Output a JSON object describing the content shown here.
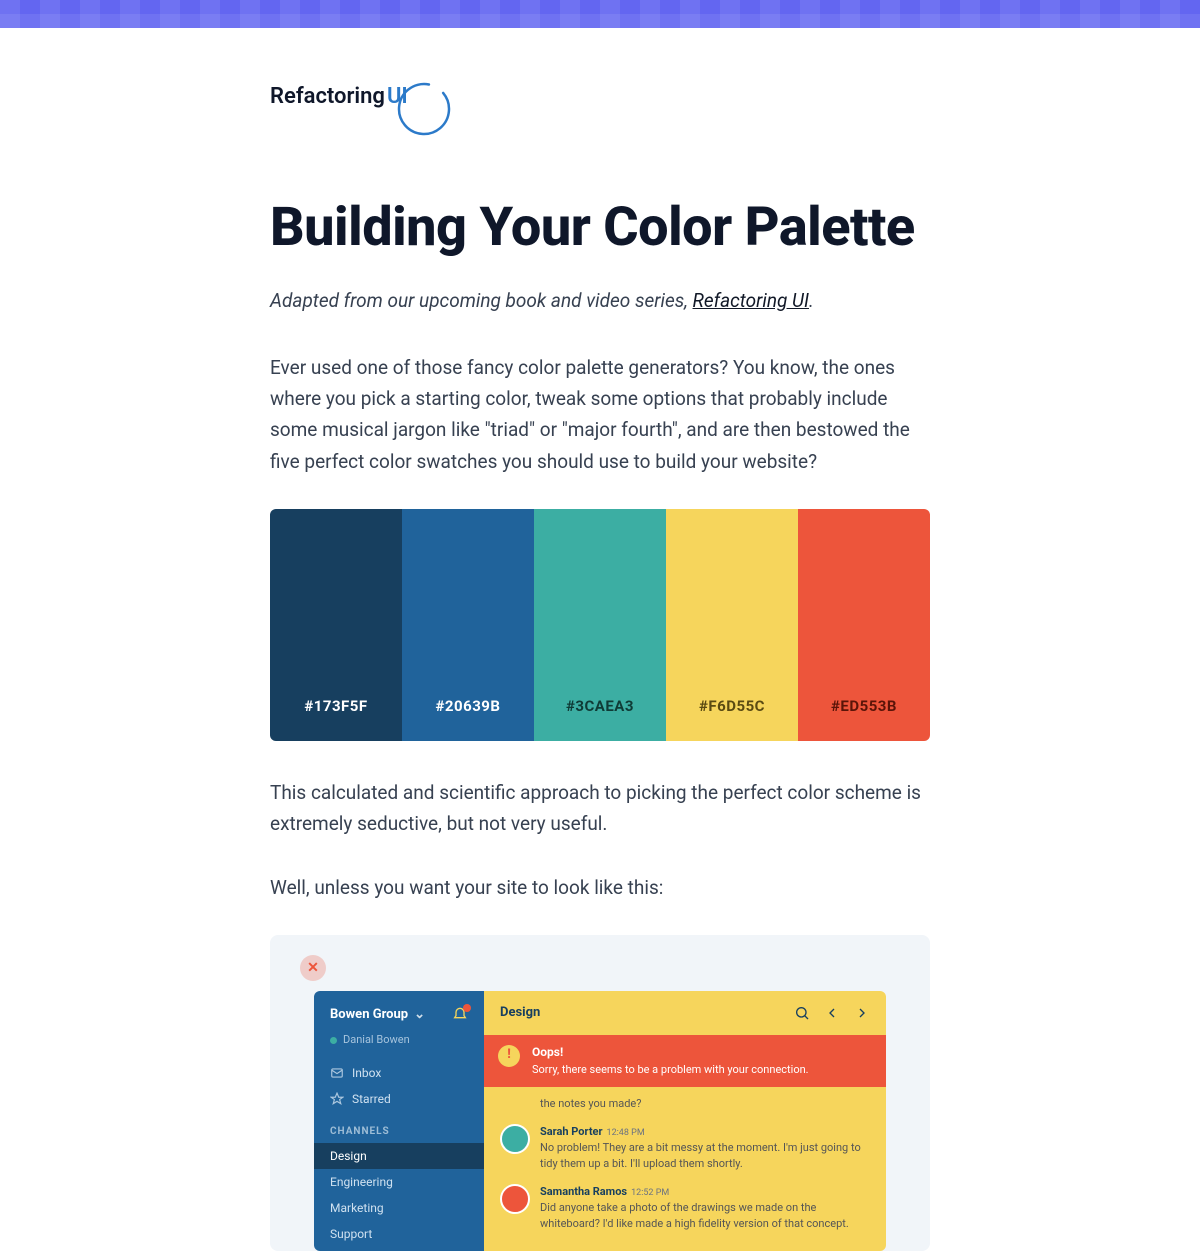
{
  "logo": {
    "word1": "Refactoring",
    "word2": "UI"
  },
  "title": "Building Your Color Palette",
  "intro": {
    "prefix": "Adapted from our upcoming book and video series, ",
    "link_text": "Refactoring UI",
    "suffix": "."
  },
  "body1": "Ever used one of those fancy color palette generators? You know, the ones where you pick a starting color, tweak some options that probably include some musical jargon like \"triad\" or \"major fourth\", and are then bestowed the five perfect color swatches you should use to build your website?",
  "palette": [
    {
      "hex": "#173F5F",
      "label_color": "#ffffff"
    },
    {
      "hex": "#20639B",
      "label_color": "#ffffff"
    },
    {
      "hex": "#3CAEA3",
      "label_color": "#0f3b36"
    },
    {
      "hex": "#F6D55C",
      "label_color": "#5a4a12"
    },
    {
      "hex": "#ED553B",
      "label_color": "#5a1408"
    }
  ],
  "body2": "This calculated and scientific approach to picking the perfect color scheme is extremely seductive, but not very useful.",
  "body3": "Well, unless you want your site to look like this:",
  "mock": {
    "team_name": "Bowen Group",
    "user_name": "Danial Bowen",
    "nav": [
      {
        "icon": "inbox-icon",
        "label": "Inbox"
      },
      {
        "icon": "star-icon",
        "label": "Starred"
      }
    ],
    "section_label": "CHANNELS",
    "channels": [
      "Design",
      "Engineering",
      "Marketing",
      "Support"
    ],
    "active_channel": "Design",
    "header_room": "Design",
    "alert_title": "Oops!",
    "alert_body": "Sorry, there seems to be a problem with your connection.",
    "orphan_line": "the notes you made?",
    "messages": [
      {
        "avatar": "a",
        "name": "Sarah Porter",
        "time": "12:48 PM",
        "text": "No problem! They are a bit messy at the moment. I'm just going to tidy them up a bit. I'll upload them shortly."
      },
      {
        "avatar": "b",
        "name": "Samantha Ramos",
        "time": "12:52 PM",
        "text": "Did anyone take a photo of the drawings we made on the whiteboard? I'd like made a high fidelity version of that concept."
      }
    ]
  }
}
